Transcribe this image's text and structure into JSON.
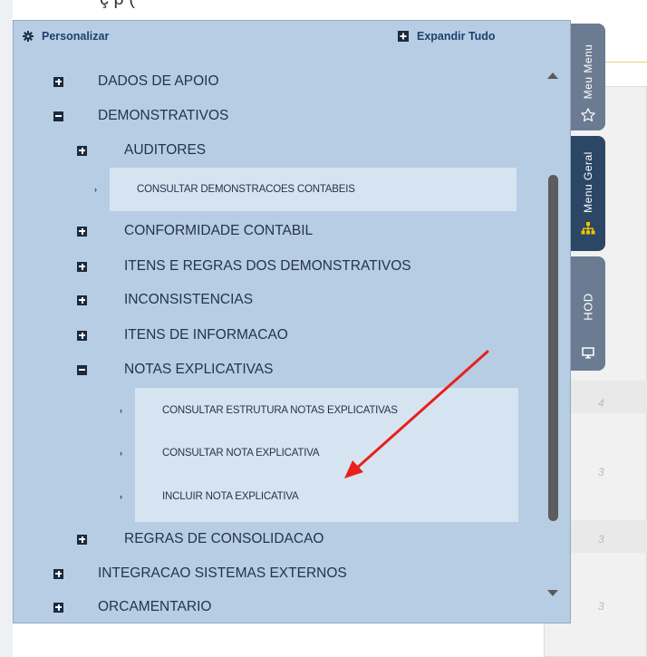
{
  "background": {
    "top_fragment": "ç                                    p              (",
    "digits": [
      "4",
      "3",
      "3",
      "3"
    ]
  },
  "header": {
    "customize_label": "Personalizar",
    "expand_label": "Expandir Tudo"
  },
  "tree": {
    "dados_de_apoio": "DADOS DE APOIO",
    "demonstrativos": "DEMONSTRATIVOS",
    "auditores": "AUDITORES",
    "consultar_demonstracoes": "CONSULTAR DEMONSTRACOES CONTABEIS",
    "conformidade_contabil": "CONFORMIDADE CONTABIL",
    "itens_e_regras": "ITENS E REGRAS DOS DEMONSTRATIVOS",
    "inconsistencias": "INCONSISTENCIAS",
    "itens_de_informacao": "ITENS DE INFORMACAO",
    "notas_explicativas": "NOTAS EXPLICATIVAS",
    "consultar_estrutura_notas": "CONSULTAR ESTRUTURA NOTAS EXPLICATIVAS",
    "consultar_nota_explicativa": "CONSULTAR NOTA EXPLICATIVA",
    "incluir_nota_explicativa": "INCLUIR NOTA EXPLICATIVA",
    "regras_de_consolidacao": "REGRAS DE CONSOLIDACAO",
    "integracao_sistemas_externos": "INTEGRACAO SISTEMAS EXTERNOS",
    "orcamentario": "ORCAMENTARIO"
  },
  "side_tabs": {
    "meu_menu": "Meu Menu",
    "menu_geral": "Menu Geral",
    "hod": "HOD"
  },
  "colors": {
    "panel": "#b7cde4",
    "leaf_highlight": "#d6e4f2",
    "active_tab": "#2c4766",
    "tab": "#6b7c92",
    "annotation_arrow": "#e8201c"
  }
}
